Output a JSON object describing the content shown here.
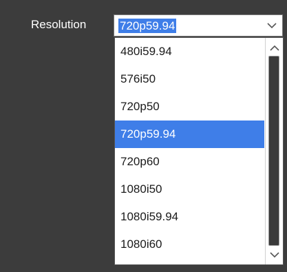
{
  "resolution": {
    "label": "Resolution",
    "selected_value": "720p59.94",
    "options": [
      "480i59.94",
      "576i50",
      "720p50",
      "720p59.94",
      "720p60",
      "1080i50",
      "1080i59.94",
      "1080i60"
    ],
    "highlighted_option": "720p59.94"
  },
  "colors": {
    "background": "#3c3c3c",
    "selection": "#3f7ee8"
  }
}
